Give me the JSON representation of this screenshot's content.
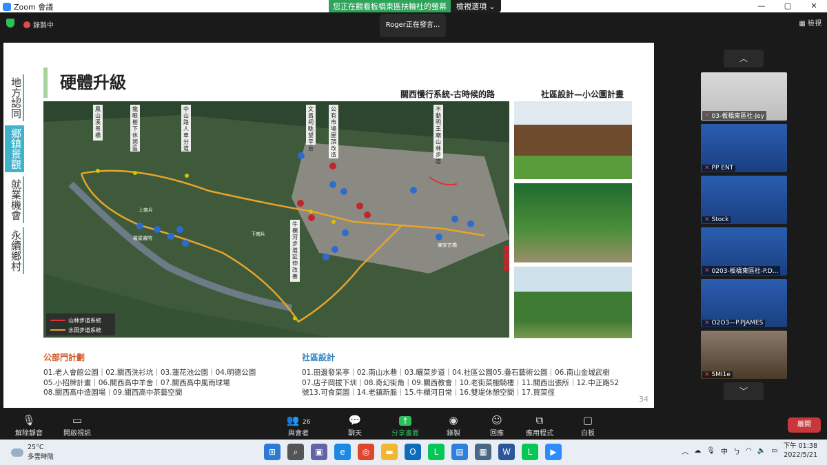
{
  "window": {
    "title": "Zoom 會議",
    "min": "—",
    "max": "▢",
    "close": "✕"
  },
  "share_banner": {
    "text": "您正在觀看板橋東區扶輪社的螢幕",
    "view_options": "檢視選項 ⌄"
  },
  "topbar": {
    "recording": "錄製中",
    "speaking": "Roger正在發言...",
    "view": "▦ 檢視"
  },
  "slide": {
    "title": "硬體升級",
    "left_nav": [
      "地方認同",
      "鄉鎮景觀",
      "就業機會",
      "永續鄉村"
    ],
    "left_nav_active": 1,
    "subtitle_map": "關西慢行系統-古時候的路",
    "subtitle_photos": "社區設計—小公園計畫",
    "map_labels": [
      "鳳山溪吊橋",
      "龍眼樹下休憩區",
      "中山路人車分道",
      "文昌祠眺望平台",
      "公有市場屋頂改造",
      "不動明王廟山林步道",
      "牛欄河步道延伸改善"
    ],
    "map_places": [
      "上南片",
      "下南片",
      "東安古橋",
      "羅屋書院"
    ],
    "legend": [
      "山林步道系統",
      "水田步道系統"
    ],
    "public_heading": "公部門計劃",
    "public_text": [
      "01.老人會館公園｜02.關西洗衫坑｜03.蓮花池公園｜04.明德公園",
      "05.小招牌計畫｜06.關西高中羊舍｜07.關西高中風雨球場",
      "08.關西高中造園場｜09.關西高中茶藝空間"
    ],
    "community_heading": "社區設計",
    "community_text": [
      "01.田邊發呆亭｜02.南山水巷｜03.曬菜步道｜04.社區公園05.疊石藝術公園｜06.南山金城武樹",
      "07.店子岡拔下圳｜08.奇幻街角｜09.關西教會｜10.老街菜棚騎樓｜11.關西出張所｜12.中正路52",
      "號13.可食菜園｜14.老鎮新脈｜15.牛欄河日常｜16.雙堤休憩空間｜17.買菜徑"
    ],
    "page_number": "34"
  },
  "gallery": {
    "up": "︿",
    "down": "﹀",
    "participants": [
      {
        "name": "03-板橋東區社-Jey"
      },
      {
        "name": "PP ENT"
      },
      {
        "name": "Stock"
      },
      {
        "name": "0203-板橋東區社-P.D..."
      },
      {
        "name": "O2O3—P.PJAMES"
      },
      {
        "name": "SMI1e"
      }
    ]
  },
  "toolbar": {
    "mute": "解除靜音",
    "video": "開啟視訊",
    "participants": "與會者",
    "participants_count": "26",
    "chat": "聊天",
    "share": "分享畫面",
    "record": "錄製",
    "reactions": "回應",
    "apps": "應用程式",
    "whiteboard": "白板",
    "leave": "離開"
  },
  "taskbar": {
    "temp": "25°C",
    "weather": "多雲時陰",
    "ime": "中",
    "ime2": "ㄅ",
    "time": "下午 01:38",
    "date": "2022/5/21"
  }
}
